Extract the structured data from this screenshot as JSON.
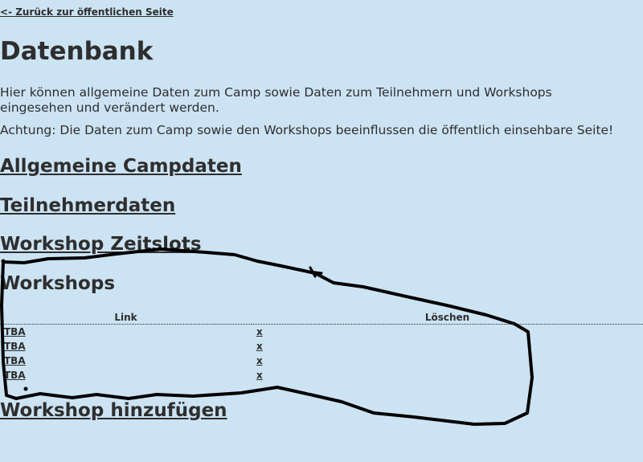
{
  "nav": {
    "back_label": "<- Zurück zur öffentlichen Seite"
  },
  "page": {
    "title": "Datenbank",
    "intro": "Hier können allgemeine Daten zum Camp sowie Daten zum Teilnehmern und Workshops eingesehen und verändert werden.",
    "warning": "Achtung: Die Daten zum Camp sowie den Workshops beeinflussen die öffentlich einsehbare Seite!"
  },
  "sections": {
    "general": "Allgemeine Campdaten",
    "participants": "Teilnehmerdaten",
    "timeslots": "Workshop Zeitslots",
    "workshops": "Workshops",
    "add_workshop": "Workshop hinzufügen"
  },
  "workshops_table": {
    "headers": {
      "link": "Link",
      "delete": "Löschen"
    },
    "rows": [
      {
        "link": "TBA",
        "delete": "x"
      },
      {
        "link": "TBA",
        "delete": "x"
      },
      {
        "link": "TBA",
        "delete": "x"
      },
      {
        "link": "TBA",
        "delete": "x"
      }
    ]
  },
  "colors": {
    "background": "#cce3f3",
    "text": "#2e2e2e",
    "annotation": "#000000"
  }
}
